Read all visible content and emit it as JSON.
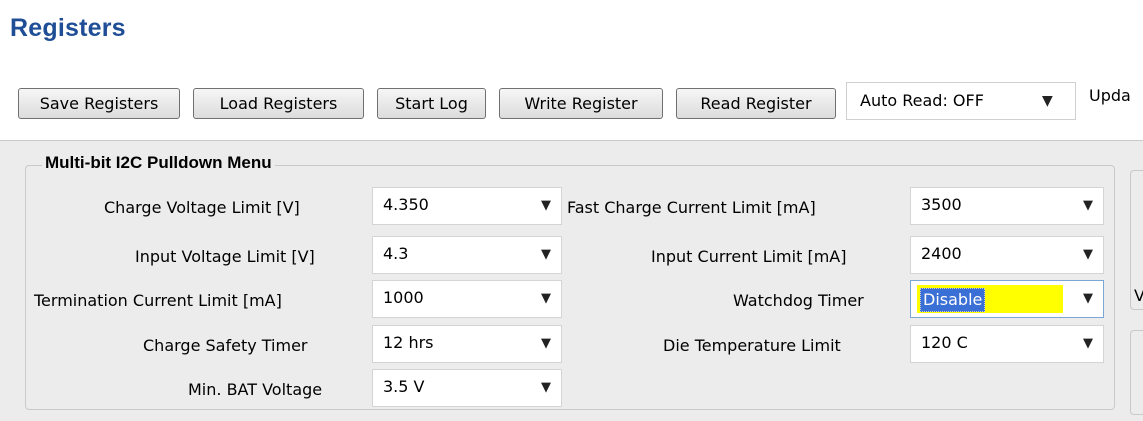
{
  "title": "Registers",
  "toolbar": {
    "buttons": [
      "Save Registers",
      "Load Registers",
      "Start Log",
      "Write Register",
      "Read Register"
    ],
    "auto_read": "Auto Read: OFF",
    "update_truncated": "Upda"
  },
  "group": {
    "title": "Multi-bit I2C Pulldown Menu",
    "left": [
      {
        "label": "Charge Voltage Limit [V]",
        "value": "4.350"
      },
      {
        "label": "Input Voltage Limit [V]",
        "value": "4.3"
      },
      {
        "label": "Termination Current Limit [mA]",
        "value": "1000"
      },
      {
        "label": "Charge Safety Timer",
        "value": "12 hrs"
      },
      {
        "label": "Min. BAT Voltage",
        "value": "3.5 V"
      }
    ],
    "right": [
      {
        "label": "Fast Charge Current Limit [mA]",
        "value": "3500"
      },
      {
        "label": "Input Current Limit [mA]",
        "value": "2400"
      },
      {
        "label": "Watchdog Timer",
        "value": "Disable"
      },
      {
        "label": "Die Temperature Limit",
        "value": "120 C"
      }
    ]
  },
  "right_partial_text": "V",
  "icons": {
    "dropdown": "chevron-down-icon"
  },
  "colors": {
    "title": "#1f4e96",
    "highlight": "#ffff00",
    "selection": "#3a6fd6"
  }
}
